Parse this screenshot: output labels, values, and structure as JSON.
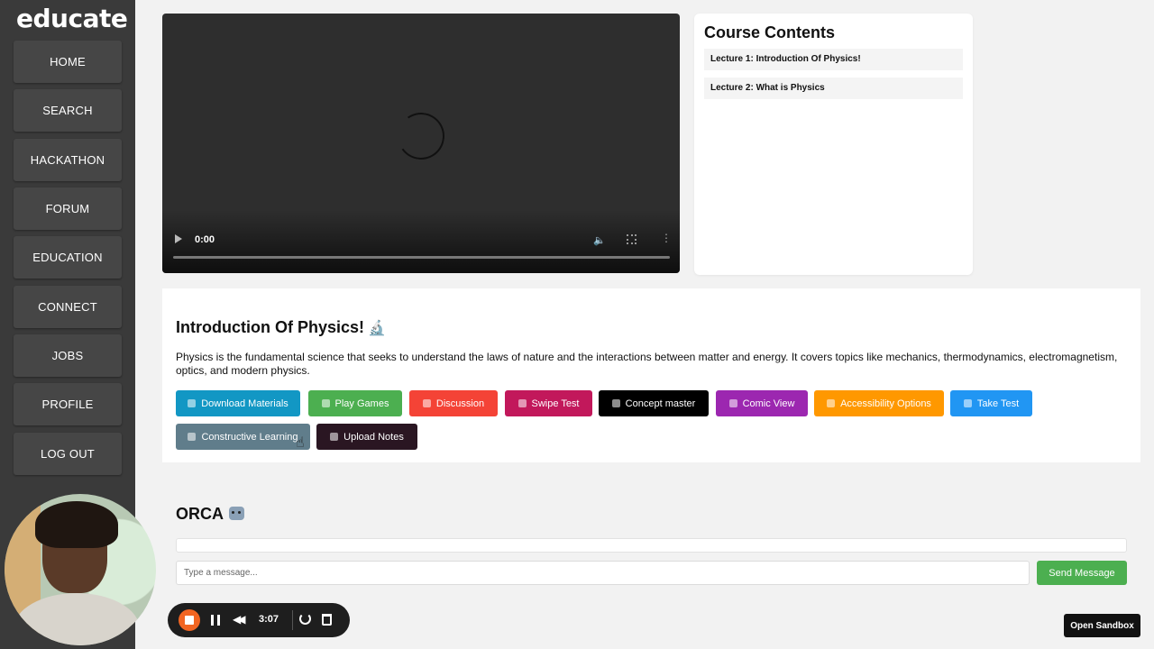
{
  "app": {
    "logo": "educate"
  },
  "sidebar": {
    "items": [
      {
        "label": "HOME"
      },
      {
        "label": "SEARCH"
      },
      {
        "label": "HACKATHON"
      },
      {
        "label": "FORUM"
      },
      {
        "label": "EDUCATION"
      },
      {
        "label": "CONNECT"
      },
      {
        "label": "JOBS"
      },
      {
        "label": "PROFILE"
      },
      {
        "label": "LOG OUT"
      }
    ]
  },
  "video": {
    "current_time": "0:00",
    "progress": 0
  },
  "course_contents": {
    "title": "Course Contents",
    "lectures": [
      {
        "label": "Lecture 1: Introduction Of Physics!"
      },
      {
        "label": "Lecture 2: What is Physics"
      }
    ]
  },
  "lesson": {
    "title": "Introduction Of Physics!",
    "title_icon": "microscope-icon",
    "description": "Physics is the fundamental science that seeks to understand the laws of nature and the interactions between matter and energy. It covers topics like mechanics, thermodynamics, electromagnetism, optics, and modern physics.",
    "actions": [
      {
        "label": "Download Materials",
        "icon": "books-icon",
        "color": "#1297c4"
      },
      {
        "label": "Play Games",
        "icon": "gamepad-icon",
        "color": "#4caf50"
      },
      {
        "label": "Discussion",
        "icon": "speech-bubble-icon",
        "color": "#f44336"
      },
      {
        "label": "Swipe Test",
        "icon": "hand-icon",
        "color": "#c2185b"
      },
      {
        "label": "Concept master",
        "icon": "books-icon",
        "color": "#000000"
      },
      {
        "label": "Comic View",
        "icon": "comic-icon",
        "color": "#9c27b0"
      },
      {
        "label": "Accessibility Options",
        "icon": "accessibility-icon",
        "color": "#ff9800"
      },
      {
        "label": "Take Test",
        "icon": "memo-icon",
        "color": "#2196f3"
      },
      {
        "label": "Constructive Learning",
        "icon": "target-icon",
        "color": "#607d8b"
      },
      {
        "label": "Upload Notes",
        "icon": "book-icon",
        "color": "#2a1622"
      }
    ]
  },
  "orca": {
    "title": "ORCA",
    "title_icon": "robot-icon",
    "input_placeholder": "Type a message...",
    "send_label": "Send Message"
  },
  "recorder": {
    "time": "3:07"
  },
  "sandbox": {
    "label": "Open Sandbox"
  }
}
